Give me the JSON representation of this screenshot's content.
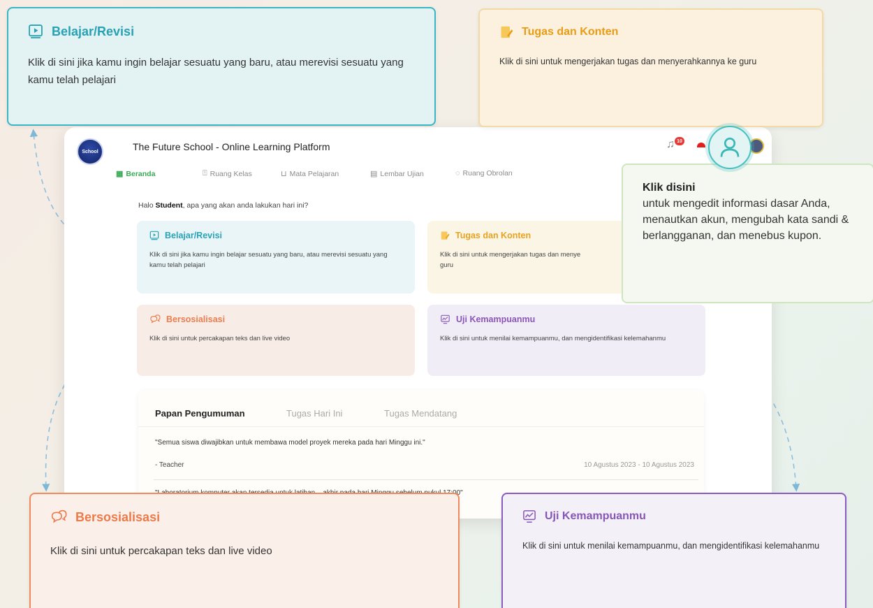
{
  "app": {
    "title": "The Future School - Online Learning Platform",
    "logo_text": "School",
    "notification_count": "10",
    "nav": [
      {
        "label": "Beranda",
        "icon": "grid-icon",
        "active": true
      },
      {
        "label": "Ruang Kelas",
        "icon": "door-icon",
        "active": false
      },
      {
        "label": "Mata Pelajaran",
        "icon": "book-icon",
        "active": false
      },
      {
        "label": "Lembar Ujian",
        "icon": "document-icon",
        "active": false
      },
      {
        "label": "Ruang Obrolan",
        "icon": "chat-icon",
        "active": false
      }
    ],
    "greeting_prefix": "Halo ",
    "greeting_name": "Student",
    "greeting_suffix": ", apa yang akan anda lakukan hari ini?",
    "cards": {
      "belajar": {
        "title": "Belajar/Revisi",
        "desc": "Klik di sini jika kamu ingin belajar sesuatu yang baru, atau merevisi sesuatu yang kamu telah pelajari"
      },
      "tugas": {
        "title": "Tugas dan Konten",
        "desc": "Klik di sini untuk mengerjakan tugas dan menye"
      },
      "tugas_desc_line2": "guru",
      "sosial": {
        "title": "Bersosialisasi",
        "desc": "Klik di sini untuk percakapan teks dan live video"
      },
      "uji": {
        "title": "Uji Kemampuanmu",
        "desc": "Klik di sini untuk menilai kemampuanmu, dan mengidentifikasi kelemahanmu"
      }
    },
    "announcements": {
      "tabs": [
        "Papan Pengumuman",
        "Tugas Hari Ini",
        "Tugas Mendatang"
      ],
      "items": [
        {
          "text": "\"Semua siswa diwajibkan untuk membawa model proyek mereka pada hari Minggu ini.\"",
          "author": "- Teacher",
          "date": "10 Agustus 2023 - 10 Agustus 2023"
        },
        {
          "text": "\"Laboratorium komputer akan tersedia untuk latihan... akhir pada hari Minggu sebelum pukul 17:00\""
        }
      ]
    }
  },
  "callouts": {
    "belajar": {
      "title": "Belajar/Revisi",
      "desc": "Klik di sini jika kamu ingin belajar sesuatu yang baru, atau merevisi sesuatu yang kamu telah pelajari"
    },
    "tugas": {
      "title": "Tugas dan Konten",
      "desc": "Klik di sini untuk mengerjakan tugas dan menyerahkannya ke guru"
    },
    "sosial": {
      "title": "Bersosialisasi",
      "desc": "Klik di sini untuk percakapan teks dan live video"
    },
    "uji": {
      "title": "Uji Kemampuanmu",
      "desc": "Klik di sini untuk menilai kemampuanmu, dan mengidentifikasi kelemahanmu"
    },
    "profil": {
      "title": "Klik disini",
      "desc": "untuk mengedit informasi dasar Anda, menautkan akun, mengubah kata sandi & berlangganan, dan menebus kupon."
    }
  },
  "colors": {
    "belajar": "#2aa3b8",
    "tugas": "#e8a21f",
    "sosial": "#ec7d4f",
    "uji": "#8a57b8",
    "active_nav": "#3aa956"
  }
}
